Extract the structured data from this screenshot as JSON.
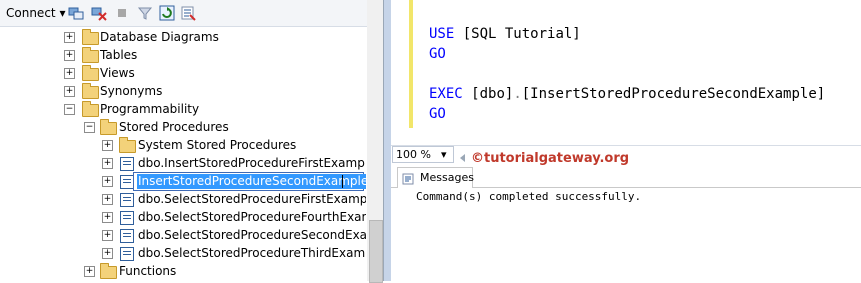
{
  "object_explorer": {
    "connect_label": "Connect",
    "connect_dropdown_glyph": "▾",
    "toolbar_icons": [
      "connect-object-explorer-icon",
      "disconnect-icon",
      "stop-icon",
      "filter-icon",
      "refresh-icon",
      "script-icon"
    ],
    "tree": [
      {
        "label": "Database Diagrams",
        "expander": "+",
        "icon": "folder-icon"
      },
      {
        "label": "Tables",
        "expander": "+",
        "icon": "folder-icon"
      },
      {
        "label": "Views",
        "expander": "+",
        "icon": "folder-icon"
      },
      {
        "label": "Synonyms",
        "expander": "+",
        "icon": "folder-icon"
      },
      {
        "label": "Programmability",
        "expander": "−",
        "icon": "folder-icon"
      },
      {
        "label": "Stored Procedures",
        "expander": "−",
        "icon": "folder-icon"
      },
      {
        "label": "System Stored Procedures",
        "expander": "+",
        "icon": "folder-icon"
      },
      {
        "label": "dbo.InsertStoredProcedureFirstExample",
        "expander": "+",
        "icon": "stored-procedure-icon"
      },
      {
        "label": "InsertStoredProcedureSecondExample",
        "expander": "+",
        "icon": "stored-procedure-icon",
        "editing": true
      },
      {
        "label": "dbo.SelectStoredProcedureFirstExample",
        "expander": "+",
        "icon": "stored-procedure-icon"
      },
      {
        "label": "dbo.SelectStoredProcedureFourthExample",
        "expander": "+",
        "icon": "stored-procedure-icon"
      },
      {
        "label": "dbo.SelectStoredProcedureSecondExample",
        "expander": "+",
        "icon": "stored-procedure-icon"
      },
      {
        "label": "dbo.SelectStoredProcedureThirdExample",
        "expander": "+",
        "icon": "stored-procedure-icon"
      },
      {
        "label": "Functions",
        "expander": "+",
        "icon": "folder-icon"
      }
    ]
  },
  "editor": {
    "line1_kw": "USE",
    "line1_rest": "[SQL Tutorial]",
    "line2_kw": "GO",
    "line4_kw": "EXEC",
    "line4_a": "[dbo]",
    "line4_dot": ".",
    "line4_b": "[InsertStoredProcedureSecondExample]",
    "line5_kw": "GO",
    "zoom": "100 %",
    "zoom_dropdown_glyph": "▾",
    "watermark": "©tutorialgateway.org",
    "messages_tab": "Messages",
    "result_text": "Command(s) completed successfully."
  },
  "colors": {
    "keyword": "#0000ff",
    "punctuation": "#808080",
    "selection": "#3399ff",
    "watermark": "#c0392b"
  }
}
